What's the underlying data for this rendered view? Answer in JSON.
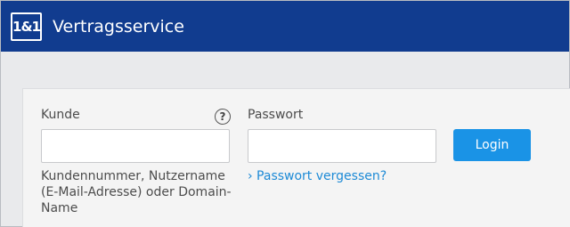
{
  "header": {
    "logo_text": "1&1",
    "title": "Vertragsservice"
  },
  "login_form": {
    "customer_label": "Kunde",
    "customer_help_icon": "question-mark",
    "customer_value": "",
    "customer_hint": "Kundennummer, Nutzername (E-Mail-Adresse) oder Domain-Name",
    "password_label": "Passwort",
    "password_value": "",
    "forgot_password_link": "› Passwort vergessen?",
    "login_button": "Login"
  },
  "colors": {
    "header_bg": "#113c8f",
    "button_bg": "#1a93e6",
    "link": "#1d8ad6"
  }
}
